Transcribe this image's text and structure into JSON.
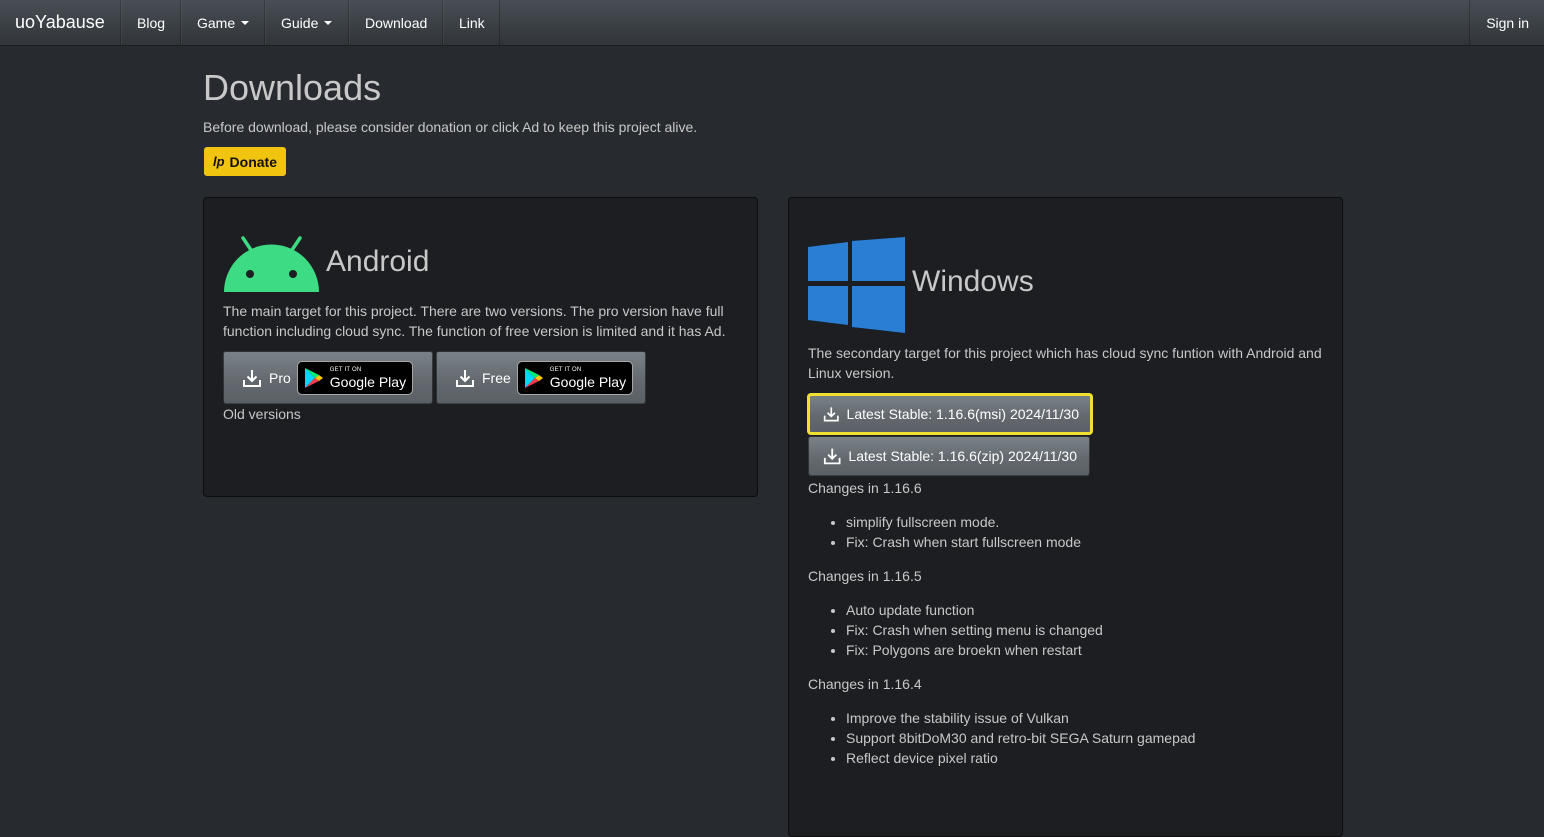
{
  "nav": {
    "brand": "uoYabause",
    "items": [
      {
        "label": "Blog",
        "dropdown": false
      },
      {
        "label": "Game",
        "dropdown": true
      },
      {
        "label": "Guide",
        "dropdown": true
      },
      {
        "label": "Download",
        "dropdown": false
      },
      {
        "label": "Link",
        "dropdown": false
      }
    ],
    "signin": "Sign in"
  },
  "page": {
    "title": "Downloads",
    "intro": "Before download, please consider donation or click Ad to keep this project alive.",
    "donate_label": "Donate",
    "donate_logo": "lp"
  },
  "android": {
    "title": "Android",
    "description": "The main target for this project. There are two versions. The pro version have full function including cloud sync. The function of free version is limited and it has Ad.",
    "pro_label": "Pro",
    "free_label": "Free",
    "badge_small": "GET IT ON",
    "badge_big": "Google Play",
    "old_versions": "Old versions",
    "colors": {
      "android_green": "#3ddc84"
    }
  },
  "windows": {
    "title": "Windows",
    "description": "The secondary target for this project which has cloud sync funtion with Android and Linux version.",
    "msi_button": "Latest Stable: 1.16.6(msi) 2024/11/30",
    "zip_button": "Latest Stable: 1.16.6(zip) 2024/11/30",
    "changes": [
      {
        "heading": "Changes in 1.16.6",
        "items": [
          "simplify fullscreen mode.",
          "Fix: Crash when start fullscreen mode"
        ]
      },
      {
        "heading": "Changes in 1.16.5",
        "items": [
          "Auto update function",
          "Fix: Crash when setting menu is changed",
          "Fix: Polygons are broekn when restart"
        ]
      },
      {
        "heading": "Changes in 1.16.4",
        "items": [
          "Improve the stability issue of Vulkan",
          "Support 8bitDoM30 and retro-bit SEGA Saturn gamepad",
          "Reflect device pixel ratio"
        ]
      }
    ],
    "colors": {
      "windows_blue": "#2a7fd4"
    }
  }
}
